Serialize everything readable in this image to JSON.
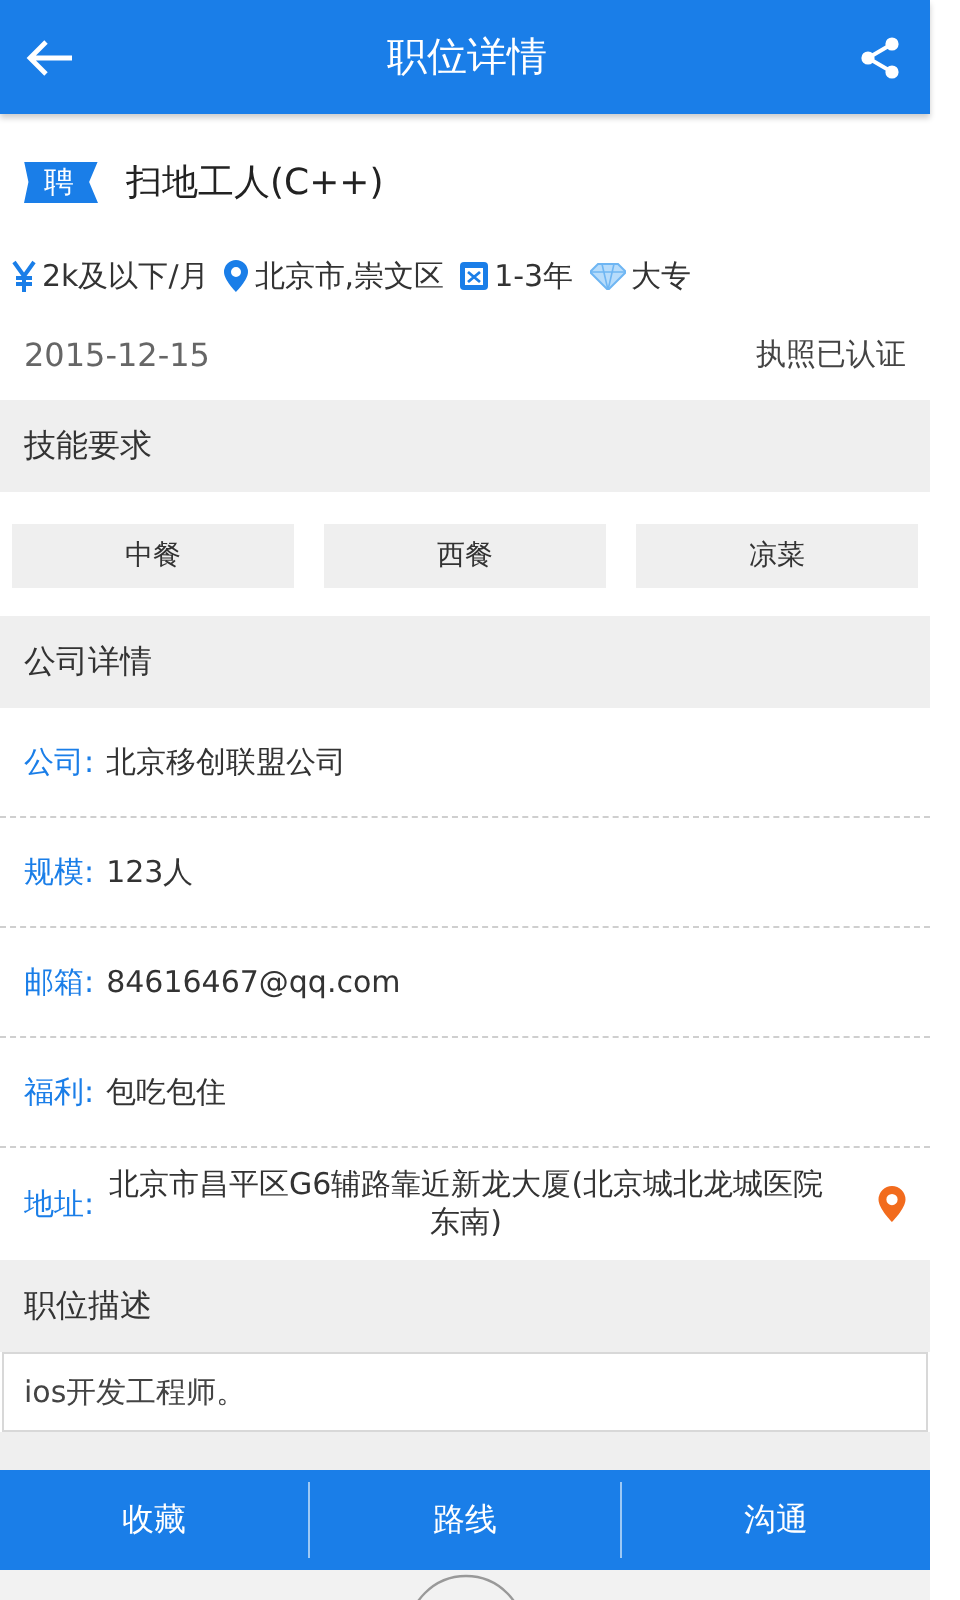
{
  "header": {
    "title": "职位详情"
  },
  "job": {
    "badge": "聘",
    "title": "扫地工人(C++)"
  },
  "meta": [
    {
      "kind": "salary",
      "text": "2k及以下/月"
    },
    {
      "kind": "location",
      "text": "北京市,崇文区"
    },
    {
      "kind": "experience",
      "text": "1-3年"
    },
    {
      "kind": "education",
      "text": "大专"
    }
  ],
  "date": "2015-12-15",
  "license": "执照已认证",
  "skills": {
    "heading": "技能要求",
    "tags": [
      "中餐",
      "西餐",
      "凉菜"
    ]
  },
  "company": {
    "heading": "公司详情",
    "rows": [
      {
        "label": "公司:",
        "value": "北京移创联盟公司"
      },
      {
        "label": "规模:",
        "value": "123人"
      },
      {
        "label": "邮箱:",
        "value": "84616467@qq.com"
      },
      {
        "label": "福利:",
        "value": "包吃包住"
      },
      {
        "label": "地址:",
        "value": "北京市昌平区G6辅路靠近新龙大厦(北京城北龙城医院东南)"
      }
    ]
  },
  "description": {
    "heading": "职位描述",
    "text": "ios开发工程师。"
  },
  "actions": [
    "收藏",
    "路线",
    "沟通"
  ]
}
